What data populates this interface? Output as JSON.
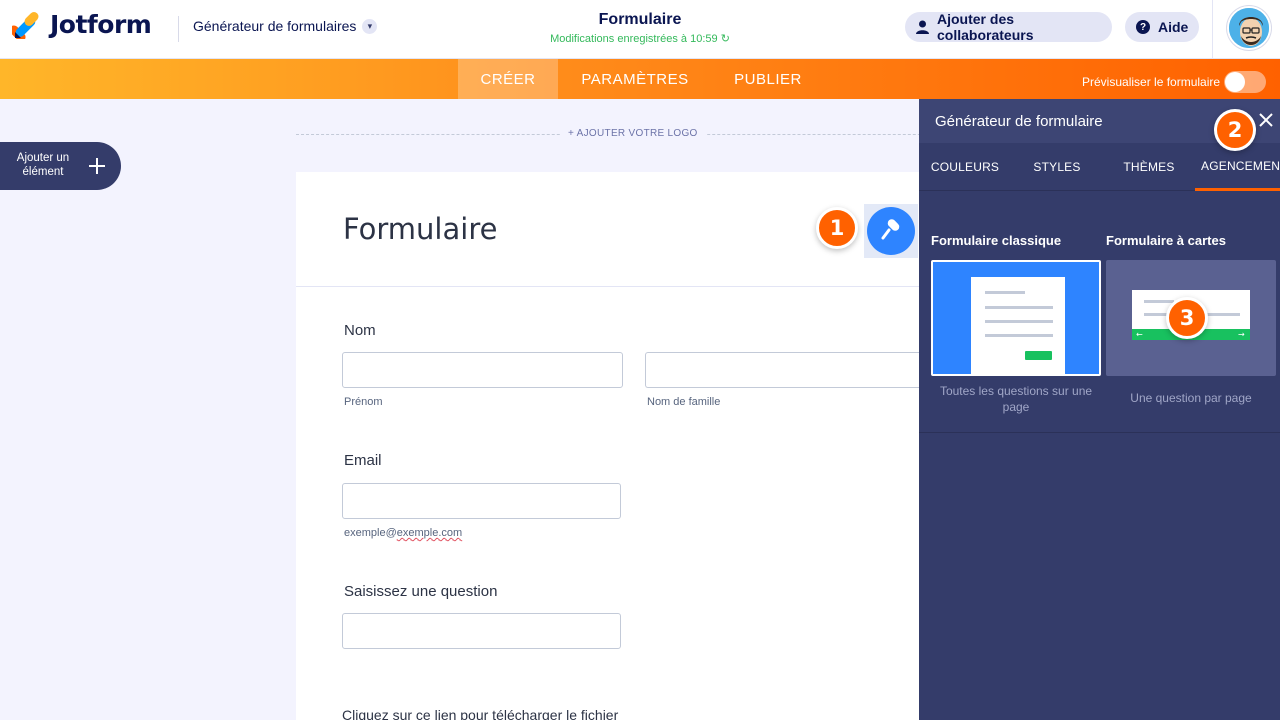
{
  "app": {
    "logo_text": "Jotform",
    "builder_label": "Générateur de formulaires"
  },
  "header": {
    "title": "Formulaire",
    "save_status": "Modifications enregistrées à 10:59",
    "collaborators_label": "Ajouter des collaborateurs",
    "help_label": "Aide"
  },
  "nav": {
    "tabs": [
      {
        "label": "CRÉER",
        "active": true
      },
      {
        "label": "PARAMÈTRES",
        "active": false
      },
      {
        "label": "PUBLIER",
        "active": false
      }
    ],
    "preview_label": "Prévisualiser le formulaire",
    "preview_enabled": false
  },
  "sidebar": {
    "add_element_label": "Ajouter un élément"
  },
  "canvas": {
    "add_logo_label": "+ AJOUTER VOTRE LOGO"
  },
  "form": {
    "title": "Formulaire",
    "fields": {
      "name_label": "Nom",
      "first_name_sub": "Prénom",
      "last_name_sub": "Nom de famille",
      "email_label": "Email",
      "email_sub_prefix": "exemple@",
      "email_sub_domain": "exemple.com",
      "question_label": "Saisissez une question",
      "download_text": "Cliquez sur ce lien pour télécharger le fichier"
    }
  },
  "panel": {
    "title": "Générateur de formulaire",
    "tabs": [
      {
        "label": "COULEURS",
        "active": false
      },
      {
        "label": "STYLES",
        "active": false
      },
      {
        "label": "THÈMES",
        "active": false
      },
      {
        "label": "AGENCEMENT",
        "active": true
      }
    ],
    "options": [
      {
        "title": "Formulaire classique",
        "description": "Toutes les questions sur une page",
        "selected": true
      },
      {
        "title": "Formulaire à cartes",
        "description": "Une question par page",
        "selected": false
      }
    ]
  },
  "callouts": [
    "1",
    "2",
    "3"
  ],
  "colors": {
    "accent": "#ff6100",
    "brand_navy": "#0a1551",
    "panel_bg": "#343c6a",
    "primary_blue": "#2e84ff",
    "saved_green": "#34b95b"
  }
}
